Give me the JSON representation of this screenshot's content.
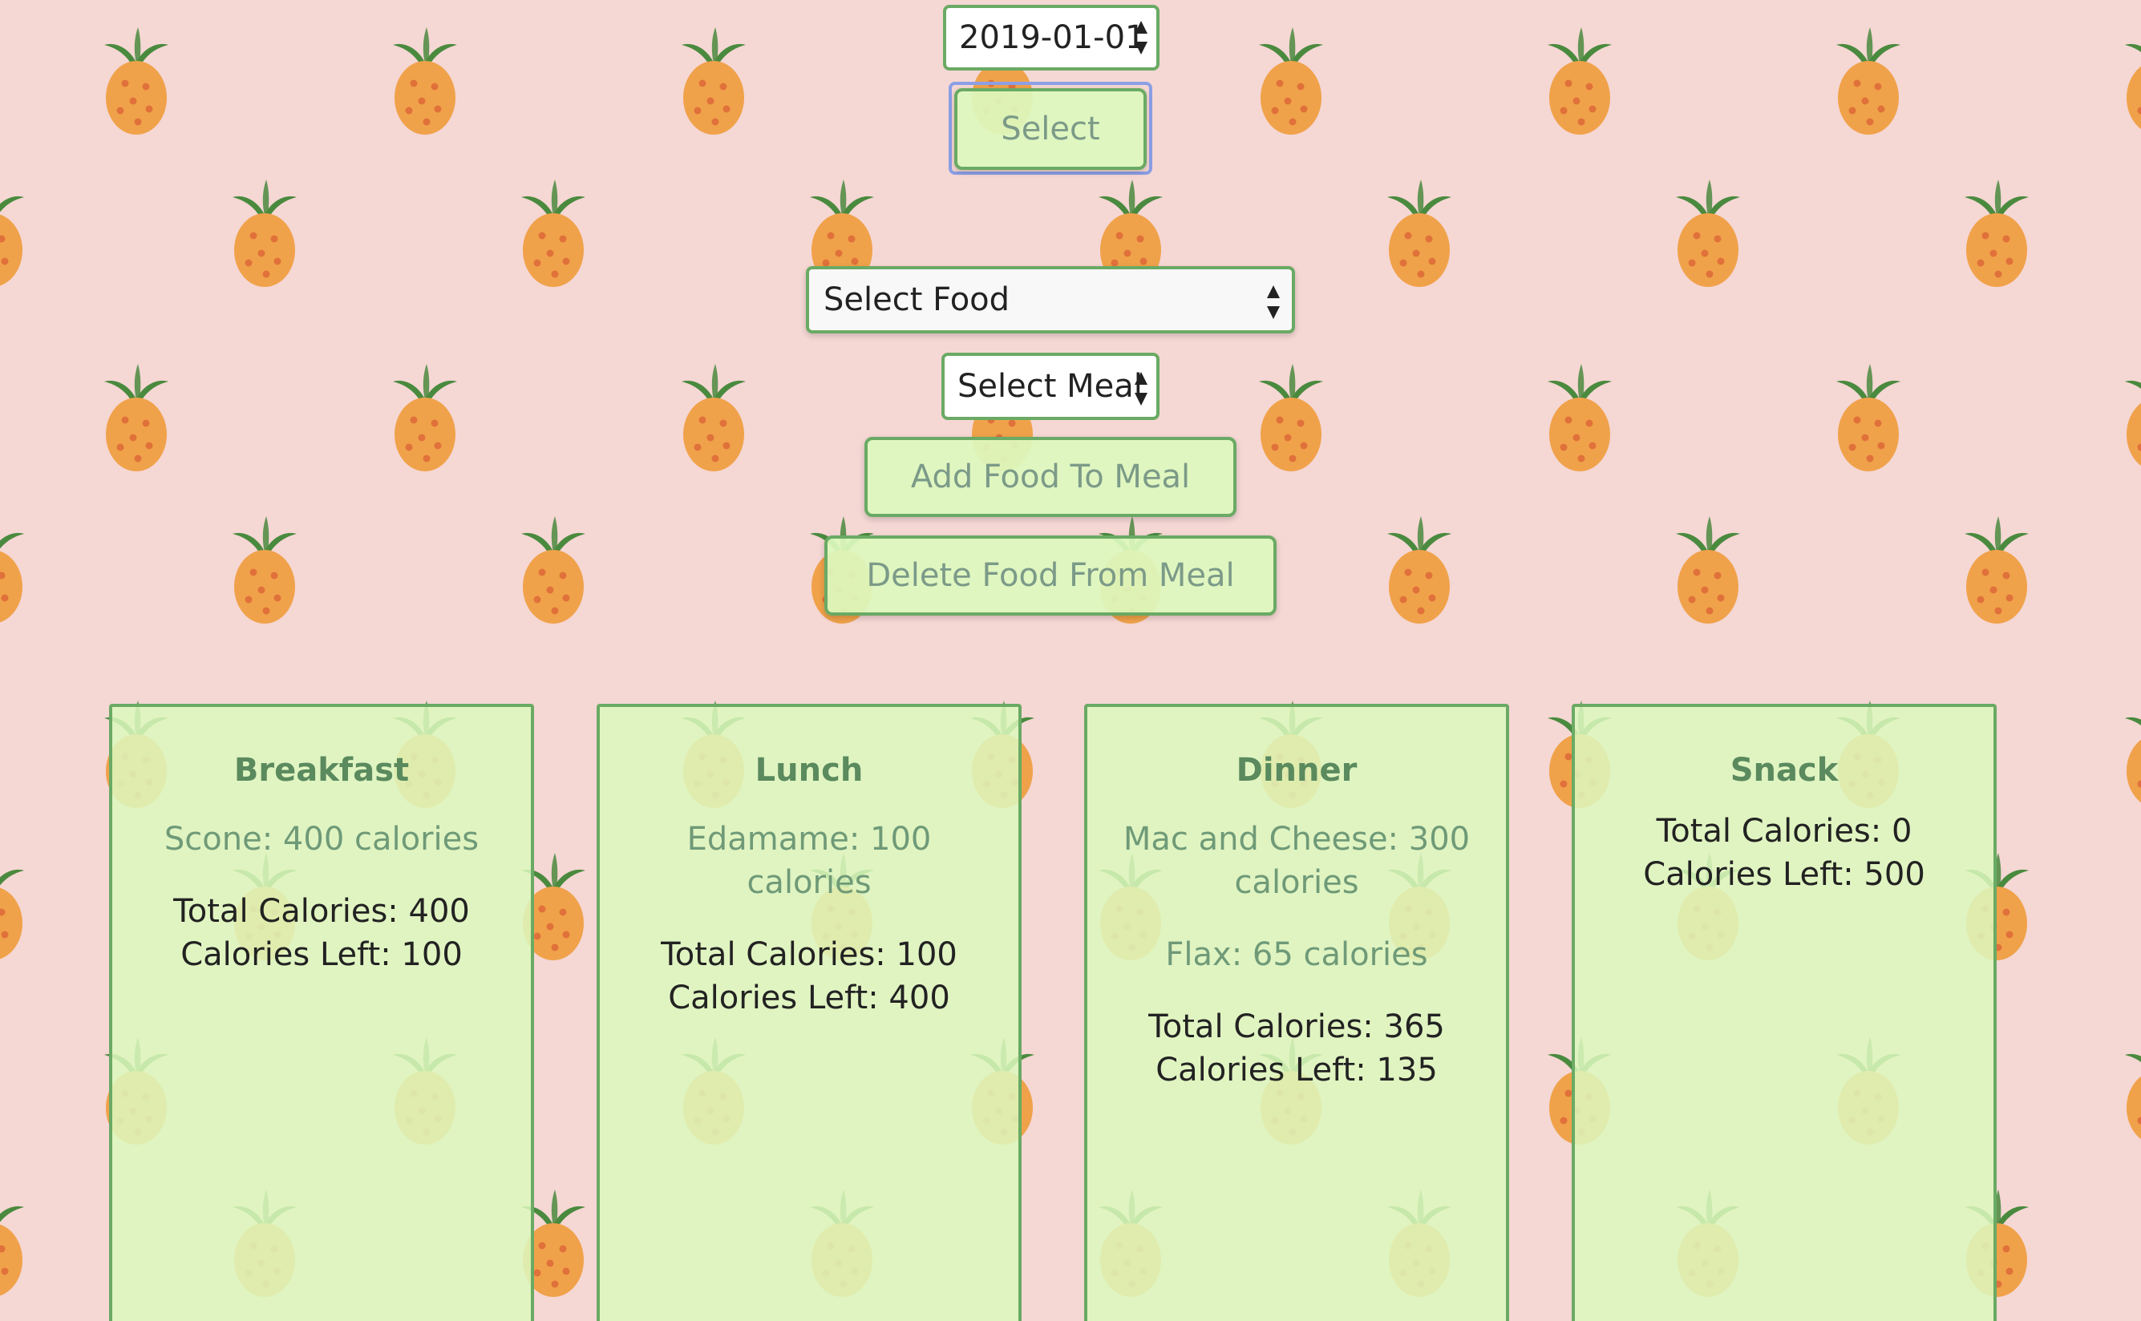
{
  "date_picker": {
    "value": "2019-01-01"
  },
  "select_button": {
    "label": "Select"
  },
  "food_select": {
    "value": "Select Food"
  },
  "meal_select": {
    "value": "Select Meal"
  },
  "add_button": {
    "label": "Add Food To Meal"
  },
  "delete_button": {
    "label": "Delete Food From Meal"
  },
  "colors": {
    "background": "#f5d7d4",
    "card": "#dcf8be",
    "border": "#6aaa64",
    "pineapple_body": "#f0a24a",
    "pineapple_leaves": "#4a8a3e",
    "focus_ring": "#8b9fe6"
  },
  "meals": [
    {
      "title": "Breakfast",
      "foods": [
        "Scone: 400 calories"
      ],
      "total": "Total Calories: 400",
      "left": "Calories Left: 100"
    },
    {
      "title": "Lunch",
      "foods": [
        "Edamame: 100 calories"
      ],
      "total": "Total Calories: 100",
      "left": "Calories Left: 400"
    },
    {
      "title": "Dinner",
      "foods": [
        "Mac and Cheese: 300 calories",
        "Flax: 65 calories"
      ],
      "total": "Total Calories: 365",
      "left": "Calories Left: 135"
    },
    {
      "title": "Snack",
      "foods": [],
      "total": "Total Calories: 0",
      "left": "Calories Left: 500"
    }
  ]
}
